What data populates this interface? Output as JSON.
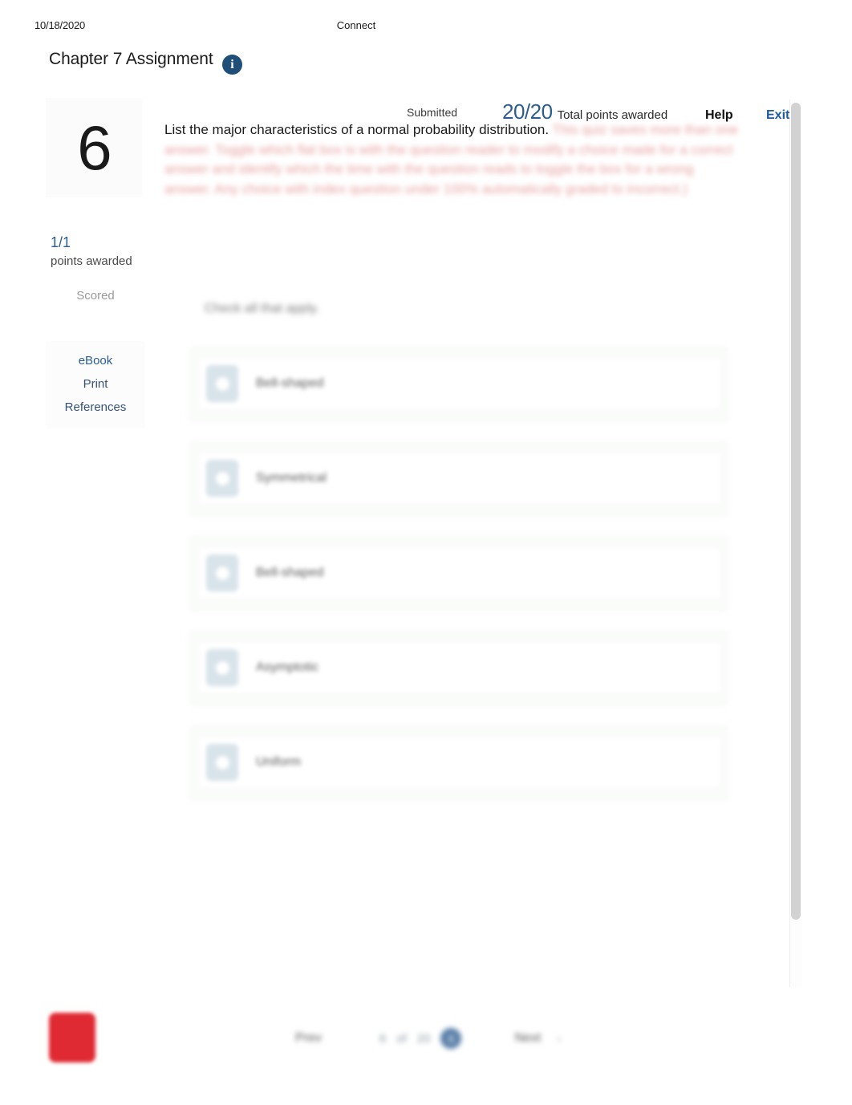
{
  "print_header": {
    "date": "10/18/2020",
    "site_title": "Connect"
  },
  "header": {
    "assignment_title": "Chapter 7 Assignment",
    "info_icon": "info-icon",
    "status": "Submitted",
    "score": "20/20",
    "score_caption": "Total points awarded",
    "help_label": "Help",
    "exit_label": "Exit"
  },
  "question_rail": {
    "number": "6",
    "points_awarded_value": "1/1",
    "points_awarded_caption": "points awarded",
    "status": "Scored",
    "links": [
      {
        "label": "eBook",
        "name": "ebook"
      },
      {
        "label": "Print",
        "name": "print"
      },
      {
        "label": "References",
        "name": "references"
      }
    ]
  },
  "question": {
    "stem": "List the major characteristics of a normal probability distribution.",
    "redacted_note": "This quiz saves more than one answer. Toggle which flat box is with the question reader to modify a choice made for a correct answer and identify which the time with the question reads to toggle the box for a wrong answer. Any choice with index question under 100% automatically graded to incorrect.)",
    "instruction": "Check all that apply.",
    "options": [
      {
        "label": "Bell-shaped",
        "handle": "drag-handle-icon"
      },
      {
        "label": "Symmetrical",
        "handle": "drag-handle-icon"
      },
      {
        "label": "Bell-shaped",
        "handle": "drag-handle-icon"
      },
      {
        "label": "Asymptotic",
        "handle": "drag-handle-icon"
      },
      {
        "label": "Uniform",
        "handle": "drag-handle-icon"
      }
    ]
  },
  "footer": {
    "logo": "mcgraw-hill-logo",
    "prev_label": "Prev",
    "pages": [
      "6",
      "of",
      "20"
    ],
    "current_page": "6",
    "next_label": "Next",
    "caret": "›"
  },
  "colors": {
    "accent_blue": "#2c5d91",
    "link_blue": "#1c5ba0",
    "info_badge": "#1f4e79",
    "logo_red": "#e02a33",
    "option_card": "#fafcfa",
    "handle_blue": "#d8e3ea"
  }
}
